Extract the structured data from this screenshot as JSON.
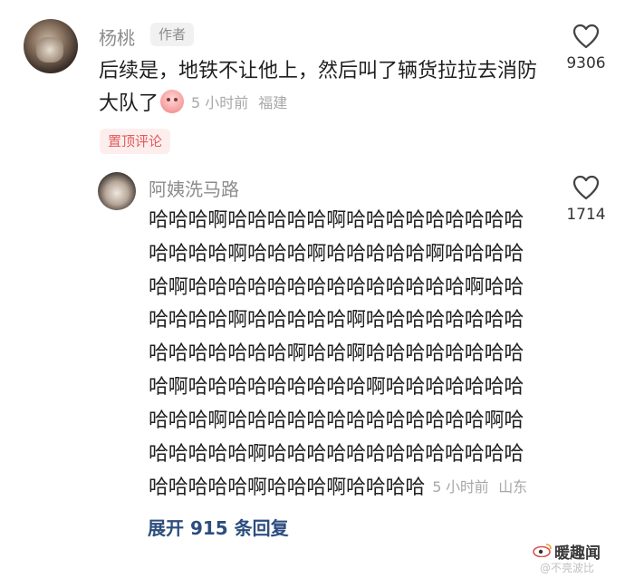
{
  "comment_main": {
    "author": "杨桃",
    "author_tag": "作者",
    "text": "后续是，地铁不让他上，然后叫了辆货拉拉去消防大队了",
    "time": "5 小时前",
    "location": "福建",
    "like_count": "9306",
    "pinned_label": "置顶评论"
  },
  "comment_reply": {
    "author": "阿姨洗马路",
    "text": "哈哈哈啊哈哈哈哈哈啊哈哈哈哈哈哈哈哈哈哈哈哈哈啊哈哈哈啊哈哈哈哈哈啊哈哈哈哈哈啊哈哈哈哈哈哈哈哈哈哈哈哈哈哈啊哈哈哈哈哈哈啊哈哈哈哈哈啊哈哈哈哈哈哈哈哈哈哈哈哈哈哈哈啊哈哈啊哈哈哈哈哈哈哈哈哈啊哈哈哈哈哈哈哈哈哈啊哈哈哈哈哈哈哈哈哈哈啊哈哈哈哈哈哈哈哈哈哈哈哈哈啊哈哈哈哈哈哈啊哈哈哈哈哈哈哈哈哈哈哈哈哈哈哈哈哈哈啊哈哈哈啊哈哈哈哈",
    "time": "5 小时前",
    "location": "山东",
    "like_count": "1714"
  },
  "expand_replies": "展开 915 条回复",
  "watermark": {
    "main": "暖趣闻",
    "sub": "@不亮波比"
  }
}
